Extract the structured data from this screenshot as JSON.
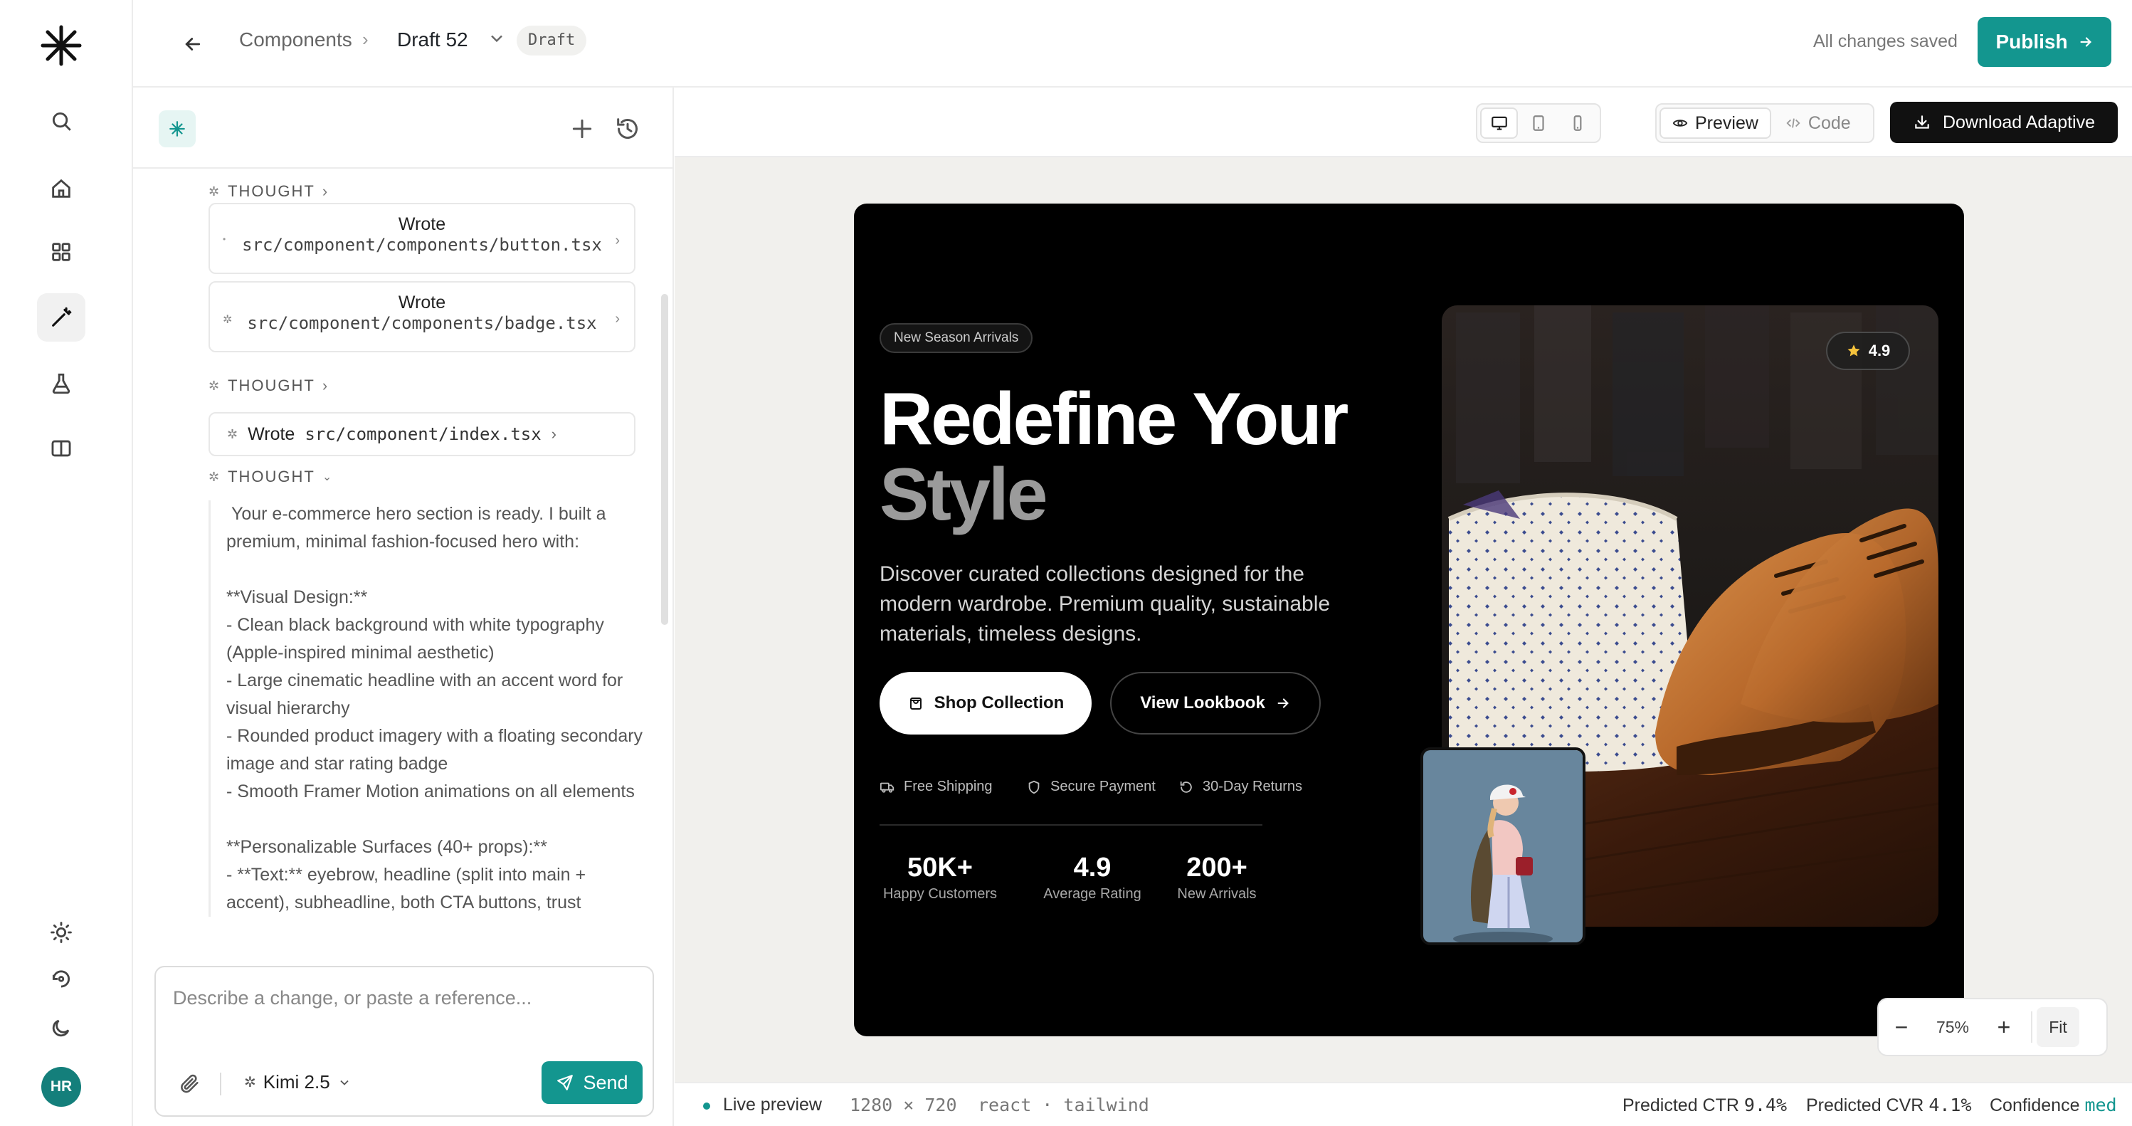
{
  "header": {
    "breadcrumb_parent": "Components",
    "draft_name": "Draft 52",
    "draft_badge": "Draft",
    "save_status": "All changes saved",
    "publish_label": "Publish"
  },
  "rail": {
    "avatar_initials": "HR",
    "active_item": "build"
  },
  "chat": {
    "thought_label": "THOUGHT",
    "entries": [
      {
        "title": "Wrote",
        "path": "src/component/components/button.tsx"
      },
      {
        "title": "Wrote",
        "path": "src/component/components/badge.tsx"
      }
    ],
    "inline_entry": {
      "title": "Wrote",
      "path": "src/component/index.tsx"
    },
    "thought_text": " Your e-commerce hero section is ready. I built a premium, minimal fashion-focused hero with:\n\n**Visual Design:**\n- Clean black background with white typography (Apple-inspired minimal aesthetic)\n- Large cinematic headline with an accent word for visual hierarchy\n- Rounded product imagery with a floating secondary image and star rating badge\n- Smooth Framer Motion animations on all elements\n\n**Personalizable Surfaces (40+ props):**\n- **Text:** eyebrow, headline (split into main + accent), subheadline, both CTA buttons, trust",
    "composer_placeholder": "Describe a change, or paste a reference...",
    "model_label": "Kimi 2.5",
    "send_label": "Send"
  },
  "preview_toolbar": {
    "devices": [
      "desktop",
      "tablet",
      "mobile"
    ],
    "active_device": "desktop",
    "preview_label": "Preview",
    "code_label": "Code",
    "download_label": "Download Adaptive"
  },
  "hero": {
    "eyebrow": "New Season Arrivals",
    "headline_main": "Redefine Your",
    "headline_accent": "Style",
    "subheadline": "Discover curated collections designed for the modern wardrobe. Premium quality, sustainable materials, timeless designs.",
    "cta_primary": "Shop Collection",
    "cta_secondary": "View Lookbook",
    "trust": [
      "Free Shipping",
      "Secure Payment",
      "30-Day Returns"
    ],
    "stats": [
      {
        "value": "50K+",
        "label": "Happy Customers"
      },
      {
        "value": "4.9",
        "label": "Average Rating"
      },
      {
        "value": "200+",
        "label": "New Arrivals"
      }
    ],
    "rating_badge": "4.9"
  },
  "zoom": {
    "minus": "−",
    "value": "75%",
    "plus": "+",
    "fit_label": "Fit"
  },
  "status_bar": {
    "live_label": "Live preview",
    "dimensions": "1280 × 720",
    "stack": "react · tailwind",
    "ctr_label": "Predicted CTR",
    "ctr_value": "9.4%",
    "cvr_label": "Predicted CVR",
    "cvr_value": "4.1%",
    "confidence_label": "Confidence",
    "confidence_value": "med"
  },
  "colors": {
    "accent": "#13968f",
    "hero_bg": "#000000",
    "canvas_bg": "#f1f0ed"
  }
}
